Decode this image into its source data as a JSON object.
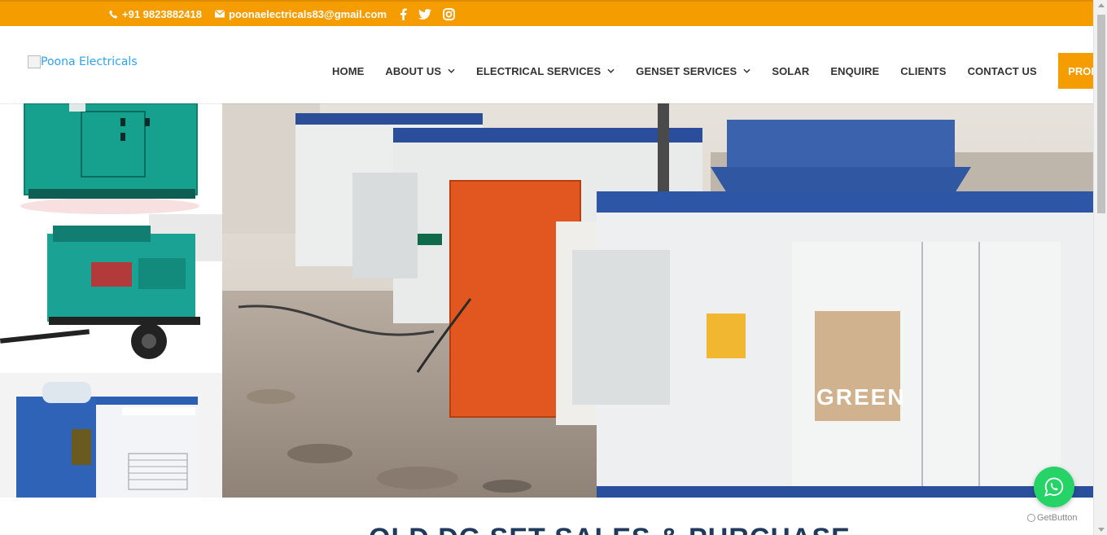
{
  "topbar": {
    "phone": "+91 9823882418",
    "email": "poonaelectricals83@gmail.com",
    "social_icons": [
      "facebook-icon",
      "twitter-icon",
      "instagram-icon"
    ],
    "bg_color": "#f59c00"
  },
  "header": {
    "logo_alt": "Poona Electricals",
    "nav": [
      {
        "label": "HOME",
        "has_dropdown": false
      },
      {
        "label": "ABOUT US",
        "has_dropdown": true
      },
      {
        "label": "ELECTRICAL SERVICES",
        "has_dropdown": true
      },
      {
        "label": "GENSET SERVICES",
        "has_dropdown": true
      },
      {
        "label": "SOLAR",
        "has_dropdown": false
      },
      {
        "label": "ENQUIRE",
        "has_dropdown": false
      },
      {
        "label": "CLIENTS",
        "has_dropdown": false
      },
      {
        "label": "CONTACT US",
        "has_dropdown": false
      }
    ],
    "profile_label": "PROFILE",
    "accent_color": "#f59c00"
  },
  "main": {
    "section_heading": "OLD DG SET SALES & PURCHASE"
  },
  "widgets": {
    "getbutton_label": "GetButton"
  }
}
